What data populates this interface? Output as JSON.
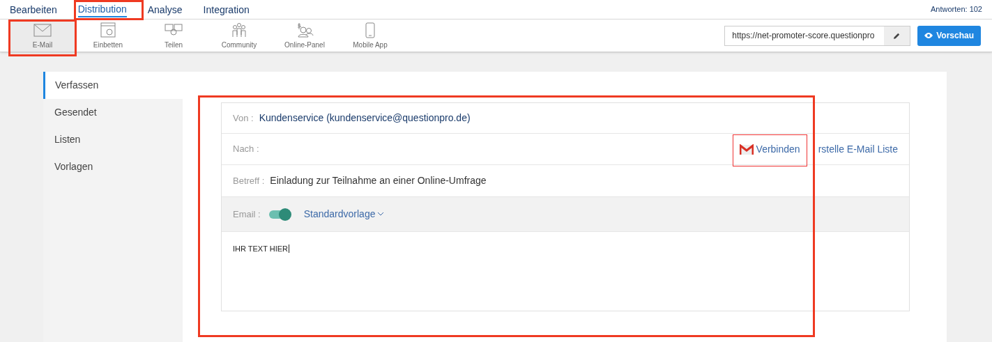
{
  "nav": {
    "tabs": [
      {
        "label": "Bearbeiten",
        "selected": false
      },
      {
        "label": "Distribution",
        "selected": true
      },
      {
        "label": "Analyse",
        "selected": false
      },
      {
        "label": "Integration",
        "selected": false
      }
    ],
    "responses": "Antworten: 102"
  },
  "toolbar": {
    "items": [
      {
        "kind": "mail",
        "label": "E-Mail",
        "selected": true
      },
      {
        "kind": "embed",
        "label": "Einbetten",
        "selected": false
      },
      {
        "kind": "share",
        "label": "Teilen",
        "selected": false
      },
      {
        "kind": "community",
        "label": "Community",
        "selected": false
      },
      {
        "kind": "panel",
        "label": "Online-Panel",
        "selected": false
      },
      {
        "kind": "mobile",
        "label": "Mobile App",
        "selected": false
      }
    ],
    "url": "https://net-promoter-score.questionpro",
    "preview_button": "Vorschau"
  },
  "sidebar": {
    "items": [
      {
        "label": "Verfassen",
        "selected": true
      },
      {
        "label": "Gesendet",
        "selected": false
      },
      {
        "label": "Listen",
        "selected": false
      },
      {
        "label": "Vorlagen",
        "selected": false
      }
    ]
  },
  "compose": {
    "from_label": "Von :",
    "from_value": "Kundenservice (kundenservice@questionpro.de)",
    "to_label": "Nach :",
    "connect_button": "Verbinden",
    "create_list_link": "rstelle E-Mail Liste",
    "subject_label": "Betreff :",
    "subject_value": "Einladung zur Teilnahme an einer Online-Umfrage",
    "email_label": "Email :",
    "email_on": true,
    "template": "Standardvorlage",
    "body": "IHR TEXT HIER"
  }
}
